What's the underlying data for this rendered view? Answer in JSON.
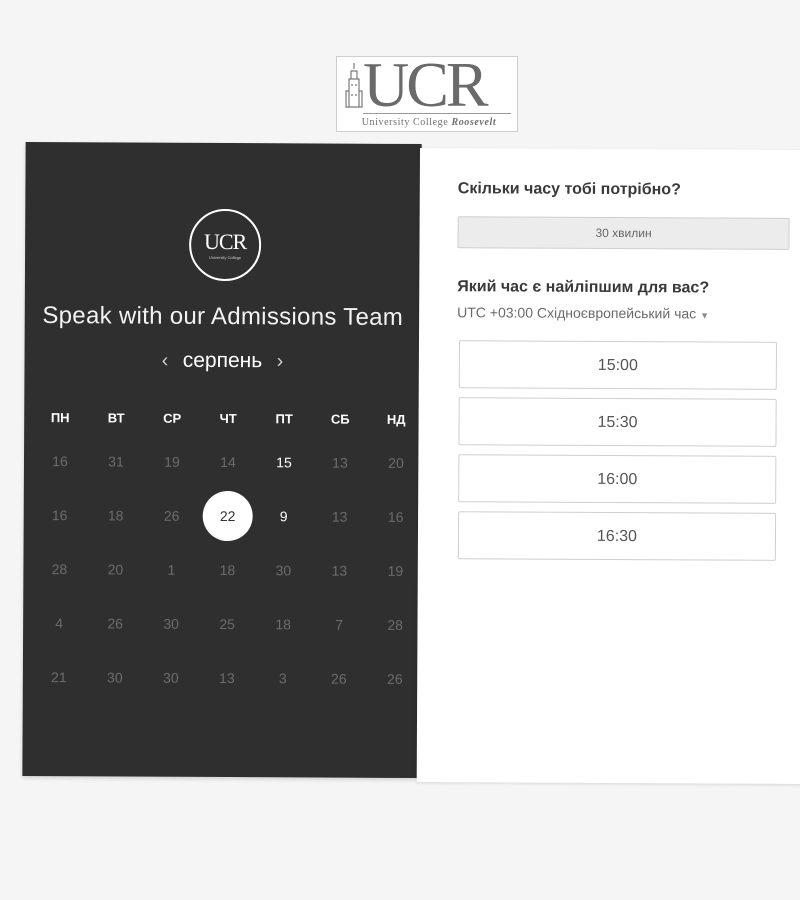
{
  "brand": {
    "logo_letters": "UCR",
    "logo_subtitle_regular": "University College",
    "logo_subtitle_italic": "Roosevelt"
  },
  "calendar": {
    "title": "Speak with our Admissions Team",
    "month": "серпень",
    "prev_arrow": "‹",
    "next_arrow": "›",
    "weekdays": [
      "ПН",
      "ВТ",
      "СР",
      "ЧТ",
      "ПТ",
      "СБ",
      "НД"
    ],
    "weeks": [
      [
        "16",
        "31",
        "19",
        "14",
        "15",
        "13",
        "20"
      ],
      [
        "16",
        "18",
        "26",
        "22",
        "9",
        "13",
        "16"
      ],
      [
        "28",
        "20",
        "1",
        "18",
        "30",
        "13",
        "19"
      ],
      [
        "4",
        "26",
        "30",
        "25",
        "18",
        "7",
        "28"
      ],
      [
        "21",
        "30",
        "30",
        "13",
        "3",
        "26",
        "26"
      ]
    ],
    "available_days": [
      "15",
      "22",
      "9"
    ],
    "selected_day": "22"
  },
  "booking": {
    "duration_question": "Скільки часу тобі потрібно?",
    "duration_value": "30 хвилин",
    "time_question": "Який час є найліпшим для вас?",
    "timezone": "UTC +03:00 Східноєвропейський час",
    "slots": [
      "15:00",
      "15:30",
      "16:00",
      "16:30"
    ]
  },
  "colors": {
    "panel_dark": "#2f2f2f",
    "background": "#f5f5f5",
    "selected_bubble": "#ffffff"
  }
}
